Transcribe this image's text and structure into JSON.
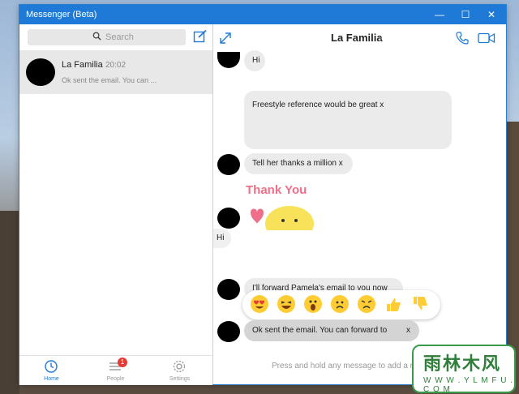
{
  "window": {
    "title": "Messenger (Beta)",
    "minimize": "—",
    "maximize": "☐",
    "close": "✕"
  },
  "sidebar": {
    "search_placeholder": "Search",
    "conversations": [
      {
        "name": "La Familia",
        "time": "20:02",
        "preview": "Ok sent the email. You can ..."
      }
    ],
    "nav": [
      {
        "label": "Home",
        "icon": "clock-icon",
        "active": true
      },
      {
        "label": "People",
        "icon": "list-icon",
        "badge": "1"
      },
      {
        "label": "Settings",
        "icon": "gear-icon"
      }
    ]
  },
  "chat": {
    "title": "La Familia",
    "chevron": "›",
    "messages": [
      {
        "text": "Hi"
      },
      {
        "text": "Freestyle reference would be great x"
      },
      {
        "text": "Tell her thanks a million x"
      },
      {
        "sticker": "thank-you-sticker",
        "sticker_text": "Thank You"
      },
      {
        "text": "Hi"
      },
      {
        "text": "I'll forward Pamela's email to you now"
      },
      {
        "text": "Ok sent the email. You can forward to"
      },
      {
        "text": "x"
      }
    ],
    "reactions": [
      "heart-eyes",
      "laughing",
      "wow",
      "sad",
      "angry",
      "thumbs-up",
      "thumbs-down"
    ],
    "hint": "Press and hold any message to add a r"
  },
  "watermark": {
    "text": "雨林木风",
    "url": "W W W . Y L M F U . C O M"
  },
  "colors": {
    "accent": "#1e7ad6",
    "bubble": "#ebebeb",
    "badge": "#e53935"
  }
}
